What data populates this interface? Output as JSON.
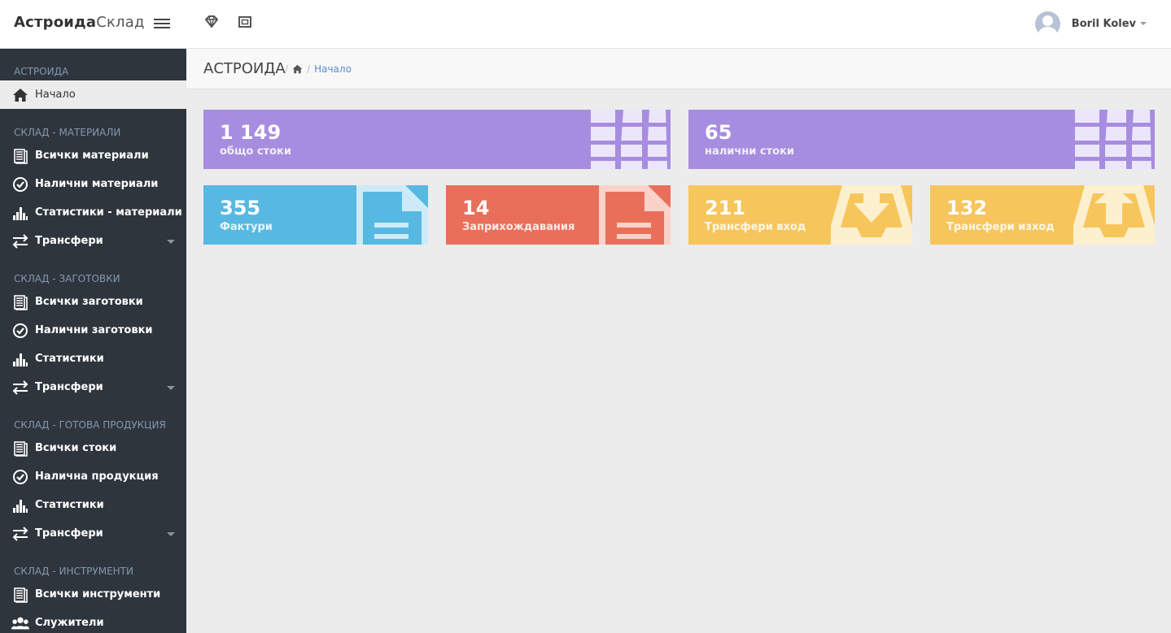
{
  "app": {
    "brand_bold": "Астроида",
    "brand_light": "Склад"
  },
  "user": {
    "name": "Boril Kolev"
  },
  "sidebar": {
    "sections": [
      {
        "title": "АСТРОИДА"
      },
      {
        "title": "СКЛАД - МАТЕРИАЛИ"
      },
      {
        "title": "СКЛАД - ЗАГОТОВКИ"
      },
      {
        "title": "СКЛАД - ГОТОВА ПРОДУКЦИЯ"
      },
      {
        "title": "СКЛАД - ИНСТРУМЕНТИ"
      }
    ],
    "items": [
      {
        "label": "Начало",
        "icon": "home-icon"
      },
      {
        "label": "Всички материали",
        "icon": "list-icon"
      },
      {
        "label": "Налични материали",
        "icon": "check-circle-icon"
      },
      {
        "label": "Статистики - материали",
        "icon": "bar-chart-icon"
      },
      {
        "label": "Трансфери",
        "icon": "transfer-icon"
      },
      {
        "label": "Всички заготовки",
        "icon": "list-icon"
      },
      {
        "label": "Налични заготовки",
        "icon": "check-circle-icon"
      },
      {
        "label": "Статистики",
        "icon": "bar-chart-icon"
      },
      {
        "label": "Трансфери",
        "icon": "transfer-icon"
      },
      {
        "label": "Всички стоки",
        "icon": "list-icon"
      },
      {
        "label": "Налична продукция",
        "icon": "check-circle-icon"
      },
      {
        "label": "Статистики",
        "icon": "bar-chart-icon"
      },
      {
        "label": "Трансфери",
        "icon": "transfer-icon"
      },
      {
        "label": "Всички инструменти",
        "icon": "list-icon"
      },
      {
        "label": "Служители",
        "icon": "users-icon"
      }
    ]
  },
  "header": {
    "title": "АСТРОИДА",
    "breadcrumb_current": "Начало"
  },
  "tiles": [
    {
      "value": "1 149",
      "label": "общо стоки",
      "color": "#a78de0",
      "icon": "boxes-icon"
    },
    {
      "value": "65",
      "label": "налични стоки",
      "color": "#a78de0",
      "icon": "boxes-icon"
    },
    {
      "value": "355",
      "label": "Фактури",
      "color": "#57b9e1",
      "icon": "document-icon"
    },
    {
      "value": "14",
      "label": "Заприхождавания",
      "color": "#ea6f5a",
      "icon": "document-icon"
    },
    {
      "value": "211",
      "label": "Трансфери вход",
      "color": "#f6c65c",
      "icon": "inbox-download-icon"
    },
    {
      "value": "132",
      "label": "Трансфери изход",
      "color": "#f6c65c",
      "icon": "inbox-upload-icon"
    }
  ]
}
